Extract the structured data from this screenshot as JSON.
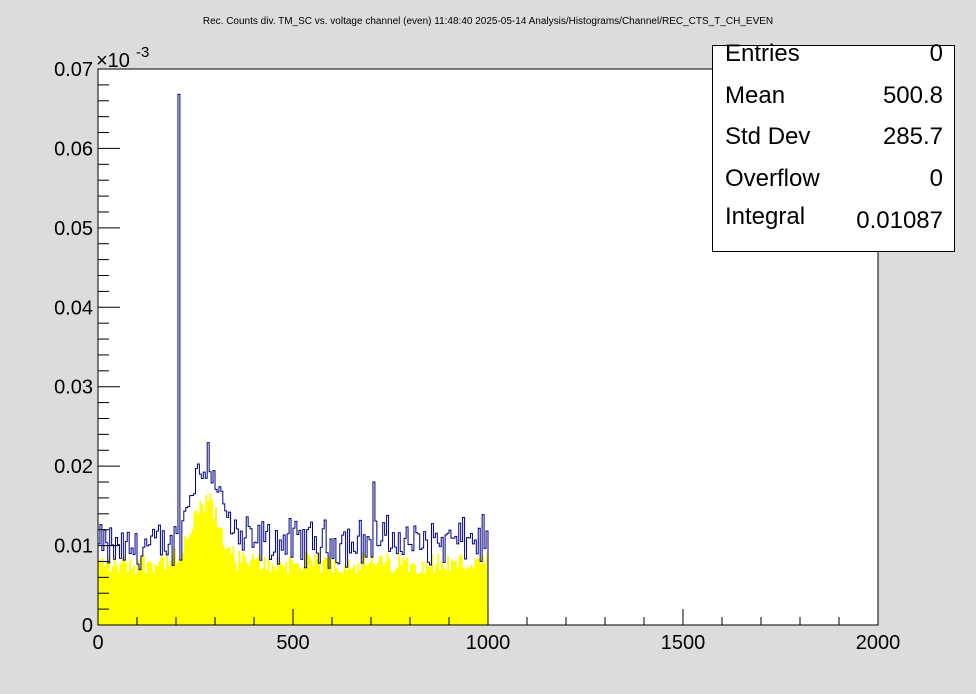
{
  "title": "Rec. Counts div. TM_SC vs. voltage channel (even)  11:48:40  2025-05-14  Analysis/Histograms/Channel/REC_CTS_T_CH_EVEN",
  "stats": [
    {
      "label": "Entries",
      "value": "0"
    },
    {
      "label": "Mean",
      "value": "500.8"
    },
    {
      "label": "Std Dev",
      "value": "285.7"
    },
    {
      "label": "Overflow",
      "value": "0"
    },
    {
      "label": "Integral",
      "value": "0.01087"
    }
  ],
  "colors": {
    "background": "#dcdcdc",
    "frame": "#ffffff",
    "fill": "#ffff00",
    "line": "#000080"
  },
  "chart_data": {
    "type": "area",
    "title": "Rec. Counts div. TM_SC vs. voltage channel (even)  11:48:40  2025-05-14  Analysis/Histograms/Channel/REC_CTS_T_CH_EVEN",
    "xlabel": "",
    "ylabel": "",
    "xlim": [
      0,
      2000
    ],
    "ylim": [
      0,
      7e-05
    ],
    "y_exponent_label": "×10",
    "y_exponent_power": "-3",
    "x_ticks": [
      "0",
      "500",
      "1000",
      "1500",
      "2000"
    ],
    "y_ticks": [
      "0",
      "0.01",
      "0.02",
      "0.03",
      "0.04",
      "0.05",
      "0.06",
      "0.07"
    ],
    "grid": false,
    "bin_width": 5,
    "series": [
      {
        "x_start": [
          0,
          50,
          100,
          150,
          200,
          205,
          210,
          215,
          220,
          240,
          260,
          280,
          300,
          320,
          350,
          400,
          450,
          500,
          600,
          700,
          705,
          710,
          800,
          900,
          950,
          1000
        ],
        "fill_values": [
          7.8e-06,
          7.7e-06,
          7.8e-06,
          8e-06,
          8.3e-06,
          8.3e-06,
          8.3e-06,
          8.6e-06,
          1e-05,
          1.25e-05,
          1.45e-05,
          1.6e-05,
          1.35e-05,
          1.1e-05,
          8.2e-06,
          7.8e-06,
          7.8e-06,
          7.8e-06,
          7.8e-06,
          7.8e-06,
          7.8e-06,
          7.8e-06,
          7.8e-06,
          7.8e-06,
          7.8e-06,
          0
        ],
        "line_values": [
          1e-05,
          9.5e-06,
          9.7e-06,
          1e-05,
          1.02e-05,
          6.68e-05,
          1.1e-05,
          1.2e-05,
          1.4e-05,
          1.75e-05,
          2e-05,
          2.15e-05,
          1.8e-05,
          1.5e-05,
          1.1e-05,
          1.05e-05,
          1.03e-05,
          1.05e-05,
          1.03e-05,
          1.05e-05,
          1.8e-05,
          1.1e-05,
          1.03e-05,
          1.05e-05,
          1.07e-05,
          0
        ]
      }
    ]
  }
}
